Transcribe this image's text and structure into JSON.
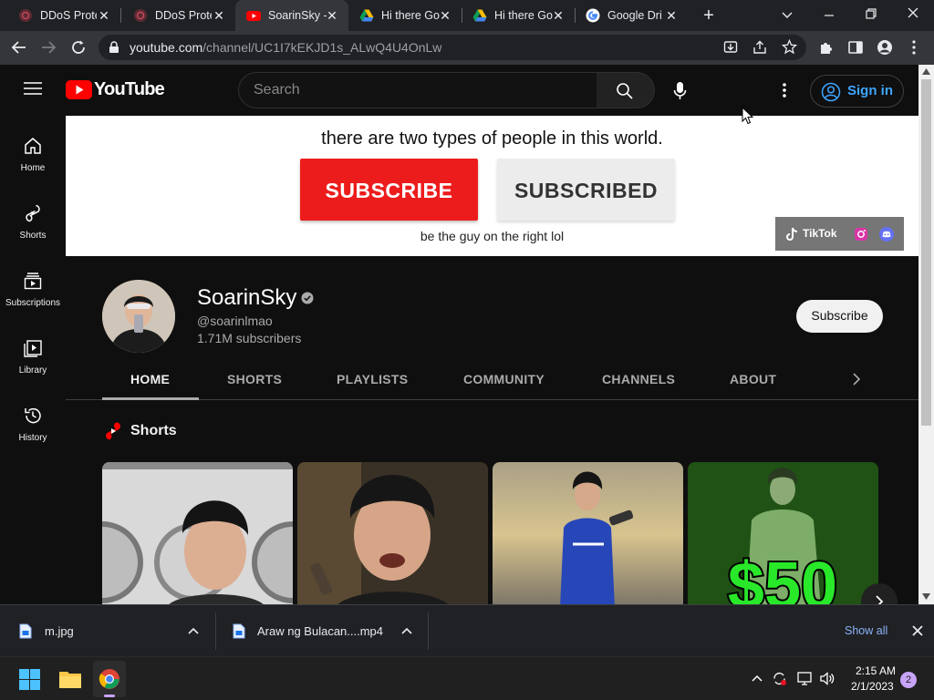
{
  "browser": {
    "tabs": [
      {
        "title": "DDoS Protection",
        "favicon": "shield-icon",
        "active": false
      },
      {
        "title": "DDoS Protection",
        "favicon": "shield-icon",
        "active": false
      },
      {
        "title": "SoarinSky - YouTube",
        "favicon": "youtube-icon",
        "active": true
      },
      {
        "title": "Hi there Google Drive",
        "favicon": "google-drive-icon",
        "active": false
      },
      {
        "title": "Hi there Google Drive",
        "favicon": "google-drive-icon",
        "active": false
      },
      {
        "title": "Google Drive",
        "favicon": "google-icon",
        "active": false
      }
    ],
    "tab_labels": [
      "DDoS Prote",
      "DDoS Prote",
      "SoarinSky -",
      "Hi there Go",
      "Hi there Go",
      "Google Dri"
    ],
    "url_host": "youtube.com",
    "url_path": "/channel/UC1I7kEKJD1s_ALwQ4U4OnLw"
  },
  "youtube": {
    "logo_text": "YouTube",
    "search_placeholder": "Search",
    "signin_label": "Sign in",
    "sidebar": [
      {
        "label": "Home",
        "icon": "home-icon"
      },
      {
        "label": "Shorts",
        "icon": "shorts-icon"
      },
      {
        "label": "Subscriptions",
        "icon": "subscriptions-icon"
      },
      {
        "label": "Library",
        "icon": "library-icon"
      },
      {
        "label": "History",
        "icon": "history-icon"
      }
    ],
    "banner": {
      "line1": "there are two types of people in this world.",
      "button_red": "SUBSCRIBE",
      "button_grey": "SUBSCRIBED",
      "line2": "be the guy on the right lol",
      "tiktok_label": "TikTok"
    },
    "channel": {
      "name": "SoarinSky",
      "handle": "@soarinlmao",
      "subscribers": "1.71M subscribers",
      "subscribe_label": "Subscribe",
      "verified": true
    },
    "tabs": [
      "HOME",
      "SHORTS",
      "PLAYLISTS",
      "COMMUNITY",
      "CHANNELS",
      "ABOUT"
    ],
    "active_tab": "HOME",
    "shorts_section_title": "Shorts",
    "short_overlay_text": "$50"
  },
  "downloads": {
    "items": [
      {
        "name": "m.jpg"
      },
      {
        "name": "Araw ng Bulacan....mp4"
      }
    ],
    "show_all": "Show all"
  },
  "taskbar": {
    "time": "2:15 AM",
    "date": "2/1/2023",
    "notification_count": "2"
  },
  "colors": {
    "youtube_red": "#ff0000",
    "link_blue": "#3ea6ff",
    "banner_red_button": "#ed1c1c"
  }
}
